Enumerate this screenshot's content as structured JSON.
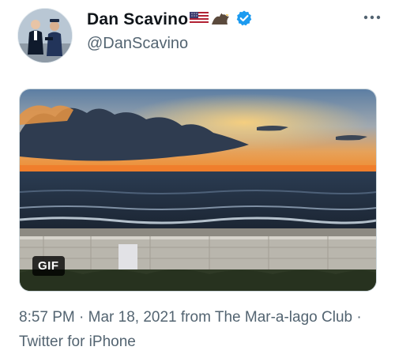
{
  "tweet": {
    "author": {
      "display_name": "Dan Scavino",
      "handle": "@DanScavino",
      "verified": true,
      "name_emojis": [
        "us-flag-icon",
        "eagle-icon"
      ]
    },
    "media": {
      "type": "gif",
      "badge": "GIF",
      "description_icon": "sunset-ocean-gif"
    },
    "meta": {
      "time": "8:57 PM",
      "separator": "·",
      "date": "Mar 18, 2021",
      "location_prefix": "from",
      "location": "The Mar-a-lago Club",
      "source": "Twitter for iPhone"
    },
    "colors": {
      "verified": "#1d9bf0",
      "name_text": "#0f1419",
      "secondary_text": "#536471"
    }
  }
}
